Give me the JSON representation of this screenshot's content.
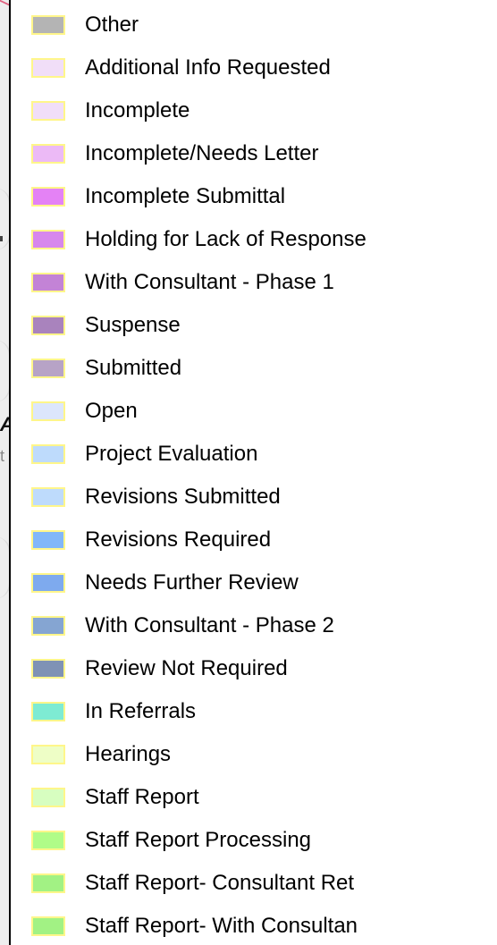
{
  "legend": {
    "items": [
      {
        "label": "Other",
        "color": "#b4b4b4"
      },
      {
        "label": "Additional Info Requested",
        "color": "#f1def8"
      },
      {
        "label": "Incomplete",
        "color": "#f1def8"
      },
      {
        "label": "Incomplete/Needs Letter",
        "color": "#ecbaf6"
      },
      {
        "label": "Incomplete Submittal",
        "color": "#e482f5"
      },
      {
        "label": "Holding for Lack of Response",
        "color": "#d787ec"
      },
      {
        "label": "With Consultant - Phase 1",
        "color": "#c383d6"
      },
      {
        "label": "Suspense",
        "color": "#a983bd"
      },
      {
        "label": "Submitted",
        "color": "#b7a3c6"
      },
      {
        "label": "Open",
        "color": "#dce6fc"
      },
      {
        "label": "Project Evaluation",
        "color": "#bedbfc"
      },
      {
        "label": "Revisions Submitted",
        "color": "#bedbfc"
      },
      {
        "label": "Revisions Required",
        "color": "#82b7f9"
      },
      {
        "label": "Needs Further Review",
        "color": "#7eaaee"
      },
      {
        "label": "With Consultant - Phase 2",
        "color": "#85a5d2"
      },
      {
        "label": "Review Not Required",
        "color": "#7f92b5"
      },
      {
        "label": "In Referrals",
        "color": "#7eebd3"
      },
      {
        "label": "Hearings",
        "color": "#eefec6"
      },
      {
        "label": "Staff Report",
        "color": "#d7fec0"
      },
      {
        "label": "Staff Report Processing",
        "color": "#b0fc88"
      },
      {
        "label": "Staff Report- Consultant Ret",
        "color": "#a2f284"
      },
      {
        "label": "Staff Report- With Consultan",
        "color": "#a2f284"
      }
    ]
  },
  "background_map": {
    "fragment_bold": "A",
    "fragment_light": "t"
  }
}
